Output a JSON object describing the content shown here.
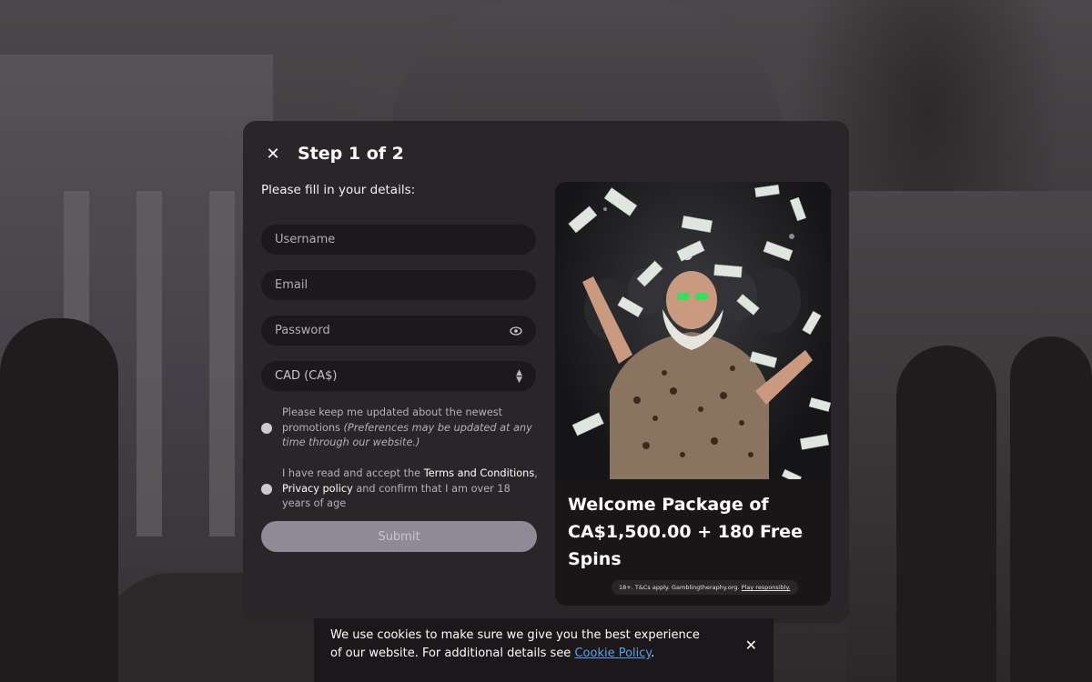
{
  "modal": {
    "step_title": "Step 1 of 2",
    "subtitle": "Please fill in your details:",
    "close_icon": "close-icon"
  },
  "form": {
    "username_placeholder": "Username",
    "email_placeholder": "Email",
    "password_placeholder": "Password",
    "currency_value": "CAD (CA$)",
    "promo_consent": "Please keep me updated about the newest promotions",
    "promo_consent_note": "(Preferences may be updated at any time through our website.)",
    "terms_prefix": "I have read and accept the",
    "terms_link": "Terms and Conditions",
    "privacy_link": "Privacy policy",
    "terms_suffix": "and confirm that I am over 18 years of age",
    "submit_label": "Submit"
  },
  "promo": {
    "headline": "Welcome Package of CA$1,500.00 + 180 Free Spins",
    "note_text": "18+. T&Cs apply. Gamblingtheraphy.org.",
    "note_link": "Play responsibly."
  },
  "cookie": {
    "message": "We use cookies to make sure we give you the best experience of our website. For additional details see",
    "link_text": "Cookie Policy",
    "end": "."
  }
}
